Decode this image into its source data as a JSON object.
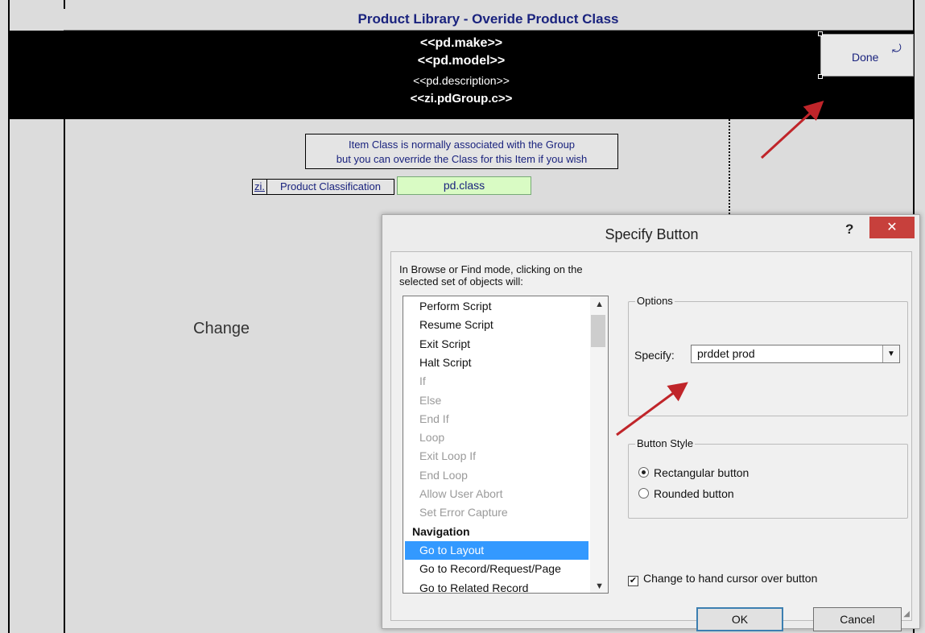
{
  "layout": {
    "title": "Product Library - Overide Product Class",
    "header_lines": [
      "<<pd.make>>",
      "<<pd.model>>",
      "<<pd.description>>",
      "<<zi.pdGroup.c>>"
    ],
    "done_label": "Done",
    "info_lines": [
      "Item Class is normally associated with the Group",
      "but you can override the Class for this Item if you wish"
    ],
    "zi_label": "zi.",
    "classification_label": "Product Classification",
    "class_field": "pd.class",
    "change_label": "Change"
  },
  "dialog": {
    "title": "Specify Button",
    "help": "?",
    "close": "✕",
    "intro": "In Browse or Find mode, clicking on the selected set of objects will:",
    "list_items": [
      {
        "label": "Perform Script",
        "style": "normal"
      },
      {
        "label": "Resume Script",
        "style": "normal"
      },
      {
        "label": "Exit Script",
        "style": "normal"
      },
      {
        "label": "Halt Script",
        "style": "normal"
      },
      {
        "label": "If",
        "style": "dim"
      },
      {
        "label": "Else",
        "style": "dim"
      },
      {
        "label": "End If",
        "style": "dim"
      },
      {
        "label": "Loop",
        "style": "dim"
      },
      {
        "label": "Exit Loop If",
        "style": "dim"
      },
      {
        "label": "End Loop",
        "style": "dim"
      },
      {
        "label": "Allow User Abort",
        "style": "dim"
      },
      {
        "label": "Set Error Capture",
        "style": "dim"
      },
      {
        "label": "Navigation",
        "style": "head"
      },
      {
        "label": "Go to Layout",
        "style": "selected"
      },
      {
        "label": "Go to Record/Request/Page",
        "style": "normal"
      },
      {
        "label": "Go to Related Record",
        "style": "normal"
      }
    ],
    "options_label": "Options",
    "specify_label": "Specify:",
    "specify_value": "prddet prod",
    "button_style_label": "Button Style",
    "radio_rect": "Rectangular button",
    "radio_round": "Rounded button",
    "radio_selected": "rectangular",
    "hand_cursor": "Change to hand cursor over button",
    "hand_cursor_checked": true,
    "ok": "OK",
    "cancel": "Cancel"
  }
}
